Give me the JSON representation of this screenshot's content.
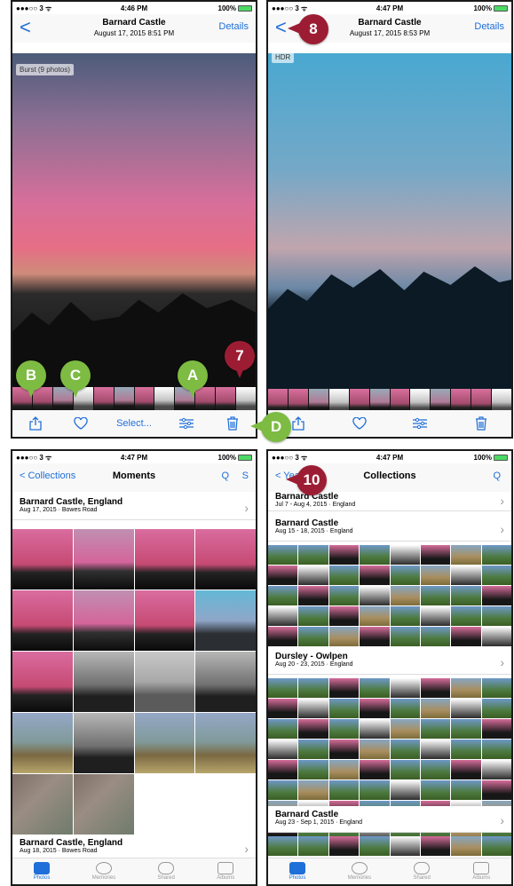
{
  "screens": {
    "s1": {
      "status": {
        "carrier": "●●●○○ 3 ᯤ",
        "time": "4:46 PM",
        "battery": "100%"
      },
      "nav": {
        "back": "<",
        "title": "Barnard Castle",
        "subtitle": "August 17, 2015  8:51 PM",
        "details": "Details"
      },
      "badge": "Burst (9 photos)",
      "toolbar": {
        "select": "Select..."
      }
    },
    "s2": {
      "status": {
        "carrier": "●●●○○ 3 ᯤ",
        "time": "4:47 PM",
        "battery": "100%"
      },
      "nav": {
        "back": "<",
        "title": "Barnard Castle",
        "subtitle": "August 17, 2015  8:53 PM",
        "details": "Details"
      },
      "badge": "HDR"
    },
    "s3": {
      "status": {
        "carrier": "●●●○○ 3 ᯤ",
        "time": "4:47 PM",
        "battery": "100%"
      },
      "nav": {
        "back": "< Collections",
        "title": "Moments",
        "search": "Q",
        "select": "S"
      },
      "sections": [
        {
          "name": "Barnard Castle, England",
          "sub": "Aug 17, 2015 · Bowes Road"
        },
        {
          "name": "Barnard Castle, England",
          "sub": "Aug 18, 2015 · Bowes Road"
        }
      ],
      "tabs": {
        "photos": "Photos",
        "memories": "Memories",
        "shared": "Shared",
        "albums": "Albums"
      }
    },
    "s4": {
      "status": {
        "carrier": "●●●○○ 3 ᯤ",
        "time": "4:47 PM",
        "battery": "100%"
      },
      "nav": {
        "back": "< Years",
        "title": "Collections",
        "search": "Q"
      },
      "sections": [
        {
          "name": "Barnard Castle",
          "sub": "Jul 7 - Aug 4, 2015 · England"
        },
        {
          "name": "Barnard Castle",
          "sub": "Aug 15 - 18, 2015 · England"
        },
        {
          "name": "Dursley - Owlpen",
          "sub": "Aug 20 - 23, 2015 · England"
        },
        {
          "name": "Barnard Castle",
          "sub": "Aug 23 - Sep 1, 2015 · England"
        }
      ],
      "tabs": {
        "photos": "Photos",
        "memories": "Memories",
        "shared": "Shared",
        "albums": "Albums"
      }
    }
  },
  "callouts": {
    "B": "B",
    "C": "C",
    "A": "A",
    "seven": "7",
    "eight": "8",
    "D": "D",
    "ten": "10"
  },
  "colors": {
    "ios_blue": "#1e6fd9",
    "callout_green": "#7dbb42",
    "callout_red": "#9c1d33"
  }
}
